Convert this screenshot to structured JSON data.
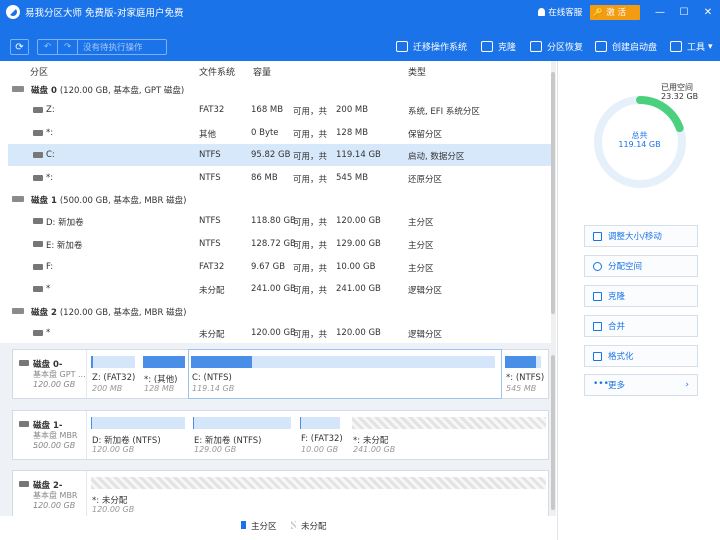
{
  "titlebar": {
    "title": "易我分区大师 免费版-对家庭用户免费",
    "support": "在线客服",
    "activate": "激 活",
    "minimize": "—",
    "maximize": "☐",
    "close": "✕"
  },
  "toolbar": {
    "refresh": "⟳",
    "undo": "↶",
    "redo": "↷",
    "pending": "没有待执行操作",
    "tools": [
      {
        "label": "迁移操作系统"
      },
      {
        "label": "克隆"
      },
      {
        "label": "分区恢复"
      },
      {
        "label": "创建启动盘"
      },
      {
        "label": "工具"
      }
    ]
  },
  "table": {
    "headers": {
      "partition": "分区",
      "fs": "文件系统",
      "capacity": "容量",
      "type": "类型"
    },
    "disks": [
      {
        "title": "磁盘 0",
        "info": "(120.00 GB, 基本盘, GPT 磁盘)",
        "rows": [
          {
            "name": "Z:",
            "fs": "FAT32",
            "used": "168 MB",
            "free_label": "可用，共",
            "total": "200 MB",
            "type": "系统, EFI 系统分区"
          },
          {
            "name": "*:",
            "fs": "其他",
            "used": "0 Byte",
            "free_label": "可用，共",
            "total": "128 MB",
            "type": "保留分区"
          },
          {
            "name": "C:",
            "fs": "NTFS",
            "used": "95.82 GB",
            "free_label": "可用，共",
            "total": "119.14 GB",
            "type": "启动, 数据分区"
          },
          {
            "name": "*:",
            "fs": "NTFS",
            "used": "86 MB",
            "free_label": "可用，共",
            "total": "545 MB",
            "type": "还原分区"
          }
        ]
      },
      {
        "title": "磁盘 1",
        "info": "(500.00 GB, 基本盘, MBR 磁盘)",
        "rows": [
          {
            "name": "D: 新加卷",
            "fs": "NTFS",
            "used": "118.80 GB",
            "free_label": "可用，共",
            "total": "120.00 GB",
            "type": "主分区"
          },
          {
            "name": "E: 新加卷",
            "fs": "NTFS",
            "used": "128.72 GB",
            "free_label": "可用，共",
            "total": "129.00 GB",
            "type": "主分区"
          },
          {
            "name": "F:",
            "fs": "FAT32",
            "used": "9.67 GB",
            "free_label": "可用，共",
            "total": "10.00 GB",
            "type": "主分区"
          },
          {
            "name": "*",
            "fs": "未分配",
            "used": "241.00 GB",
            "free_label": "可用，共",
            "total": "241.00 GB",
            "type": "逻辑分区"
          }
        ]
      },
      {
        "title": "磁盘 2",
        "info": "(120.00 GB, 基本盘, MBR 磁盘)",
        "rows": [
          {
            "name": "*",
            "fs": "未分配",
            "used": "120.00 GB",
            "free_label": "可用，共",
            "total": "120.00 GB",
            "type": "逻辑分区"
          }
        ]
      }
    ]
  },
  "diskmap": [
    {
      "name": "磁盘 0-",
      "sub": "基本盘 GPT ...",
      "size": "120.00 GB",
      "segments": [
        {
          "name": "Z: (FAT32)",
          "size": "200 MB",
          "used_fraction": 0.05
        },
        {
          "name": "*: (其他)",
          "size": "128 MB",
          "used_fraction": 1.0
        },
        {
          "name": "C: (NTFS)",
          "size": "119.14 GB",
          "used_fraction": 0.2
        },
        {
          "name": "*: (NTFS)",
          "size": "545 MB",
          "used_fraction": 0.85
        }
      ]
    },
    {
      "name": "磁盘 1-",
      "sub": "基本盘 MBR ...",
      "size": "500.00 GB",
      "segments": [
        {
          "name": "D: 新加卷 (NTFS)",
          "size": "120.00 GB",
          "used_fraction": 0.01
        },
        {
          "name": "E: 新加卷 (NTFS)",
          "size": "129.00 GB",
          "used_fraction": 0.003
        },
        {
          "name": "F: (FAT32)",
          "size": "10.00 GB",
          "used_fraction": 0.03
        },
        {
          "name": "*: 未分配",
          "size": "241.00 GB",
          "used_fraction": 0
        }
      ]
    },
    {
      "name": "磁盘 2-",
      "sub": "基本盘 MBR ...",
      "size": "120.00 GB",
      "segments": [
        {
          "name": "*: 未分配",
          "size": "120.00 GB",
          "used_fraction": 0
        }
      ]
    }
  ],
  "legend": {
    "primary": "主分区",
    "unallocated": "未分配"
  },
  "panel": {
    "used_label": "已用空间",
    "used_value": "23.32 GB",
    "total_label": "总共",
    "total_value": "119.14 GB",
    "used_fraction": 0.196,
    "actions": [
      {
        "label": "调整大小/移动"
      },
      {
        "label": "分配空间"
      },
      {
        "label": "克隆"
      },
      {
        "label": "合并"
      },
      {
        "label": "格式化"
      },
      {
        "label": "更多"
      }
    ],
    "colors": {
      "ring_used": "#4cd07d",
      "ring_free": "#e6f0fb",
      "accent": "#1a73e8"
    }
  }
}
